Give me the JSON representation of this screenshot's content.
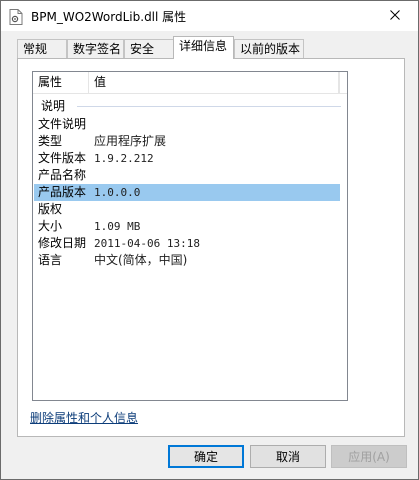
{
  "window": {
    "title": "BPM_WO2WordLib.dll 属性"
  },
  "tabs": [
    {
      "label": "常规"
    },
    {
      "label": "数字签名"
    },
    {
      "label": "安全"
    },
    {
      "label": "详细信息"
    },
    {
      "label": "以前的版本"
    }
  ],
  "details": {
    "col_property": "属性",
    "col_value": "值",
    "group_label": "说明",
    "rows": [
      {
        "name": "文件说明",
        "value": ""
      },
      {
        "name": "类型",
        "value": "应用程序扩展"
      },
      {
        "name": "文件版本",
        "value": "1.9.2.212"
      },
      {
        "name": "产品名称",
        "value": ""
      },
      {
        "name": "产品版本",
        "value": "1.0.0.0"
      },
      {
        "name": "版权",
        "value": ""
      },
      {
        "name": "大小",
        "value": "1.09 MB"
      },
      {
        "name": "修改日期",
        "value": "2011-04-06 13:18"
      },
      {
        "name": "语言",
        "value": "中文(简体，中国)"
      }
    ]
  },
  "link_remove": "删除属性和个人信息",
  "buttons": {
    "ok": "确定",
    "cancel": "取消",
    "apply": "应用(A)"
  },
  "colors": {
    "selection": "#99c9ef",
    "link": "#0d3d7a"
  }
}
